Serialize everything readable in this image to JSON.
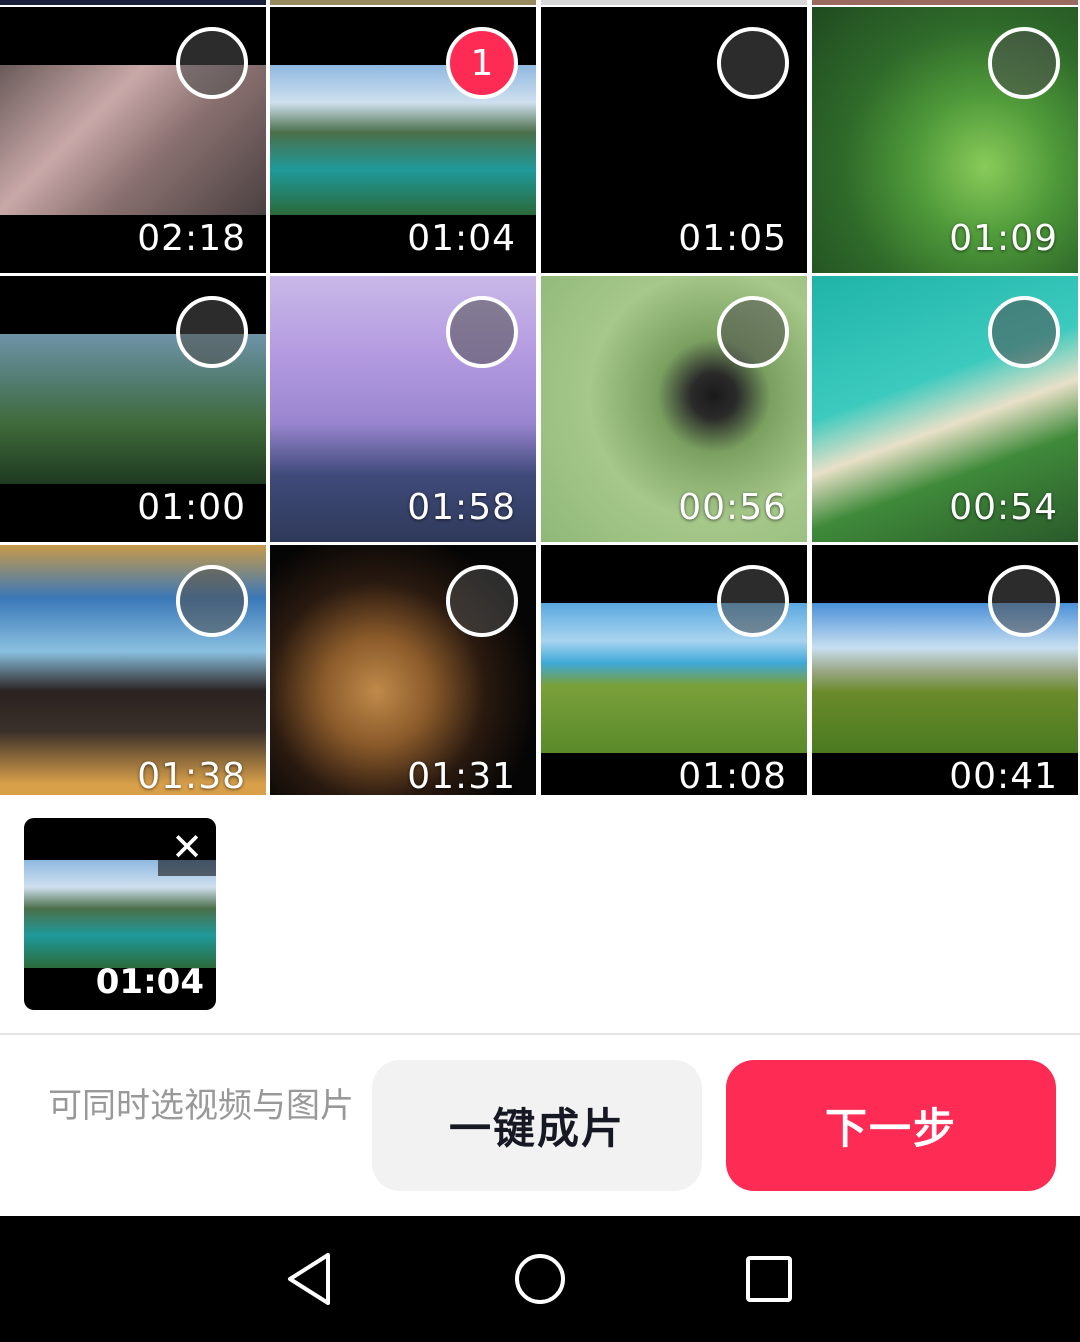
{
  "colors": {
    "accent": "#fe2c55",
    "hint_text": "#999999",
    "secondary_button_bg": "#f2f2f2"
  },
  "videos": [
    {
      "duration": "02:18",
      "selected_index": ""
    },
    {
      "duration": "01:04",
      "selected_index": "1"
    },
    {
      "duration": "01:05",
      "selected_index": ""
    },
    {
      "duration": "01:09",
      "selected_index": ""
    },
    {
      "duration": "01:00",
      "selected_index": ""
    },
    {
      "duration": "01:58",
      "selected_index": ""
    },
    {
      "duration": "00:56",
      "selected_index": ""
    },
    {
      "duration": "00:54",
      "selected_index": ""
    },
    {
      "duration": "01:38",
      "selected_index": ""
    },
    {
      "duration": "01:31",
      "selected_index": ""
    },
    {
      "duration": "01:08",
      "selected_index": ""
    },
    {
      "duration": "00:41",
      "selected_index": ""
    }
  ],
  "tray": {
    "items": [
      {
        "duration": "01:04",
        "close_icon": "close-icon"
      }
    ]
  },
  "action_bar": {
    "hint": "可同时选视频与图片",
    "auto_button_label": "一键成片",
    "next_button_label": "下一步"
  },
  "system_nav": {
    "icons": [
      "back-triangle-icon",
      "home-circle-icon",
      "recents-square-icon"
    ]
  }
}
